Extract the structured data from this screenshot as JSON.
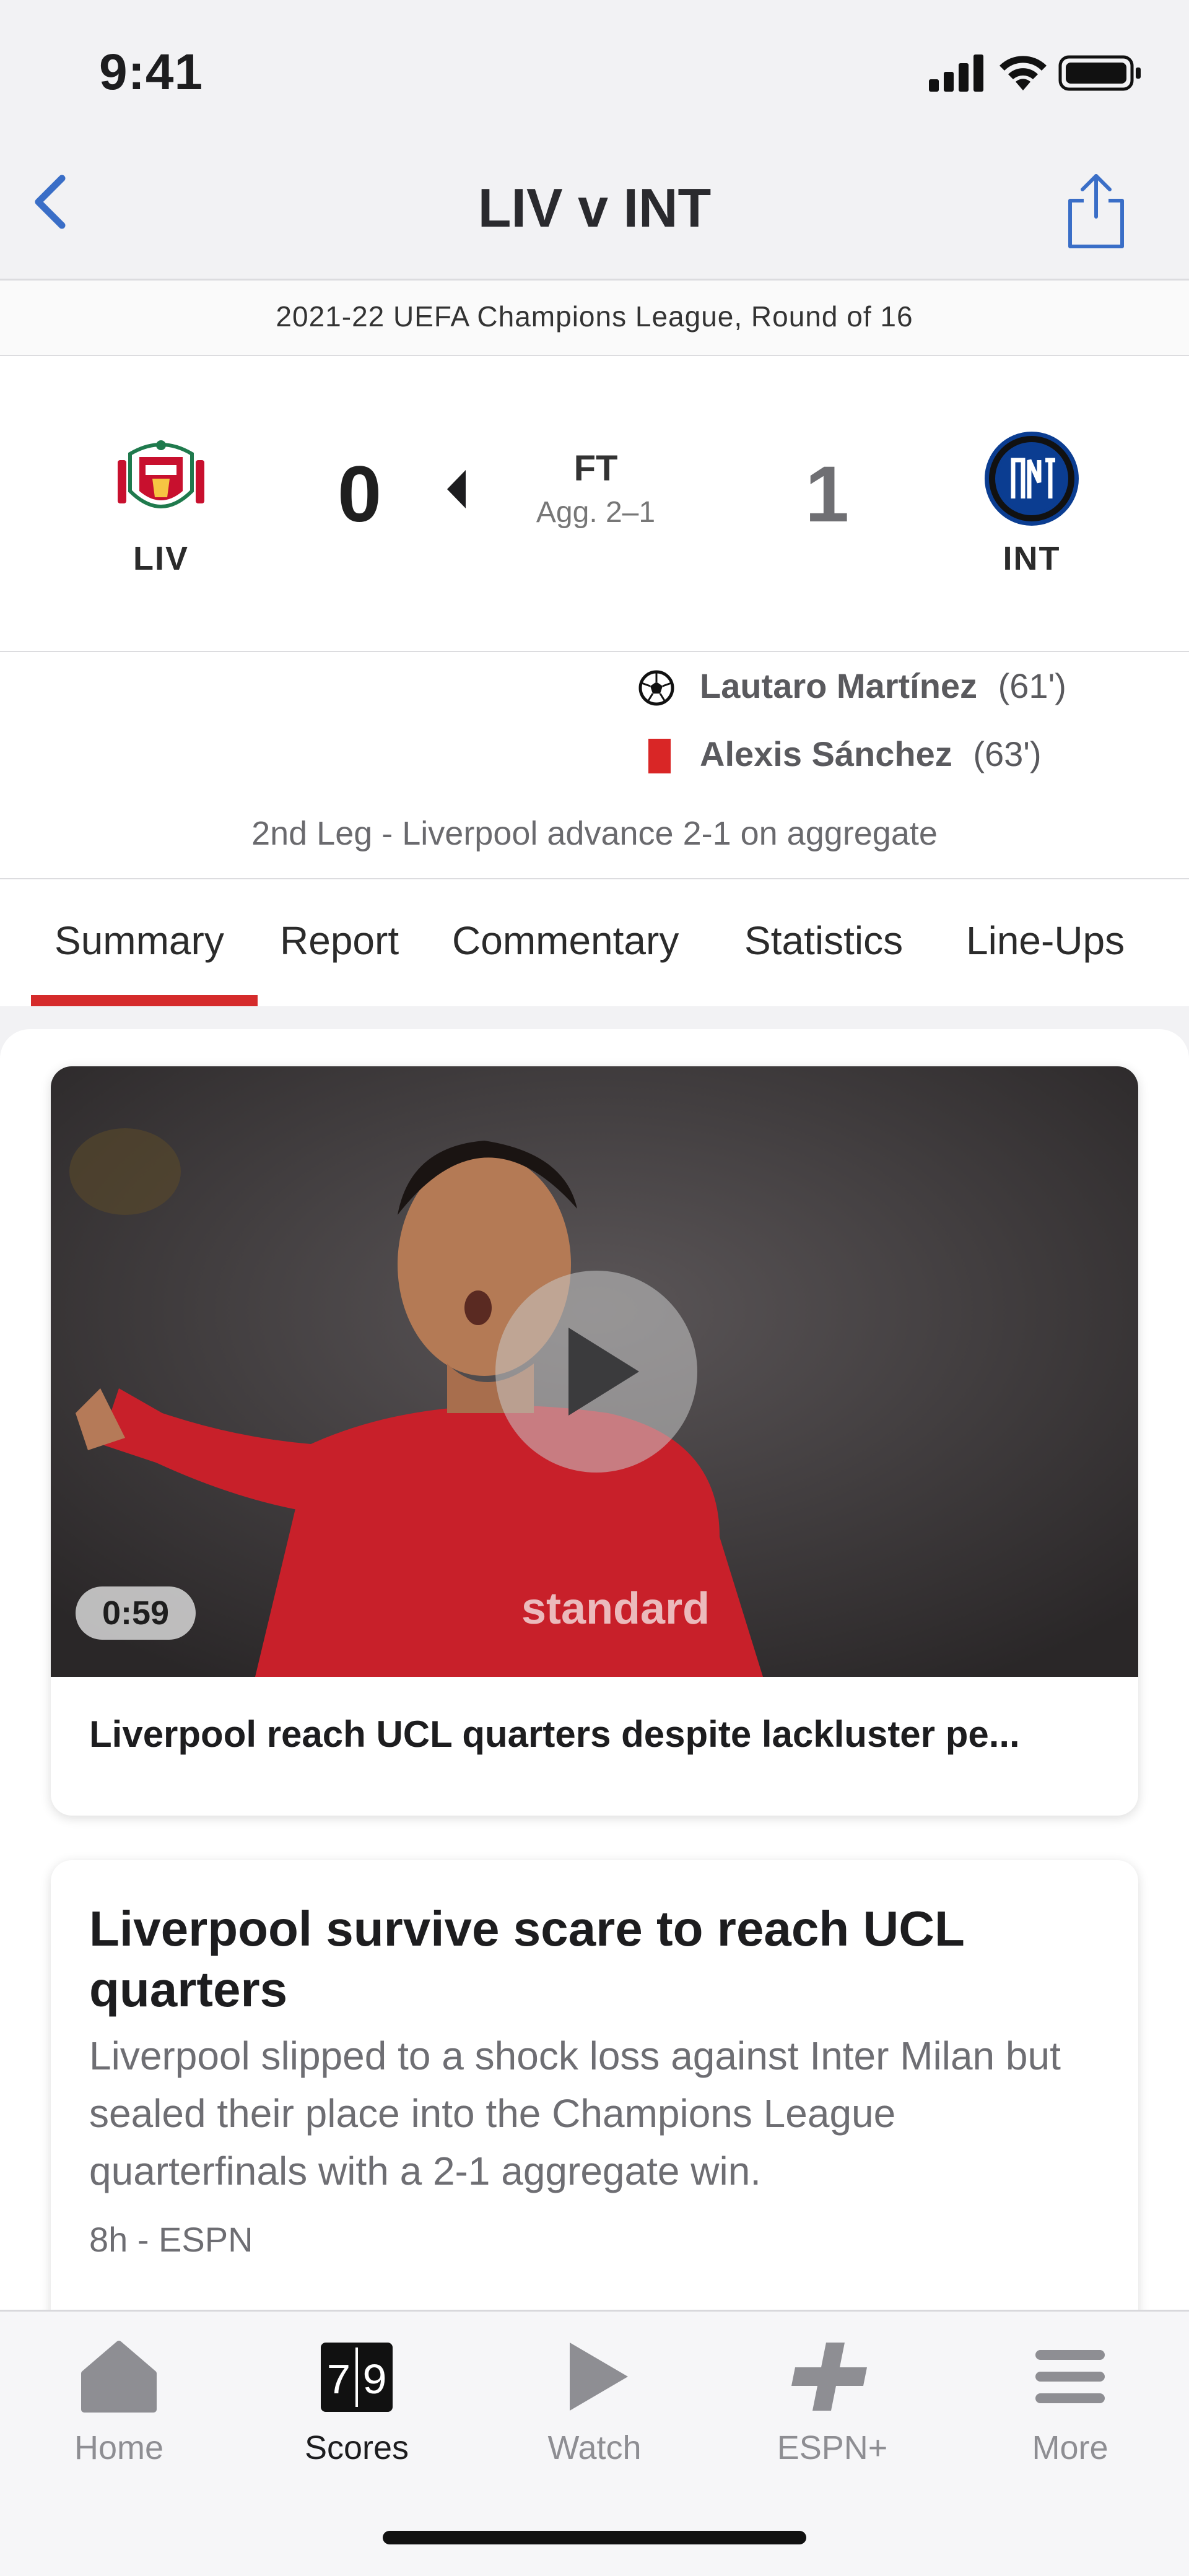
{
  "status_bar": {
    "time": "9:41"
  },
  "nav": {
    "title": "LIV v INT"
  },
  "competition": "2021-22 UEFA Champions League, Round of 16",
  "match": {
    "home": {
      "abbr": "LIV",
      "score": "0"
    },
    "away": {
      "abbr": "INT",
      "score": "1"
    },
    "status": "FT",
    "aggregate": "Agg. 2–1"
  },
  "events": [
    {
      "type": "goal",
      "icon": "soccer-ball-icon",
      "player": "Lautaro Martínez",
      "minute": "(61')"
    },
    {
      "type": "red-card",
      "icon": "red-card-icon",
      "player": "Alexis Sánchez",
      "minute": "(63')"
    }
  ],
  "leg_note": "2nd Leg - Liverpool advance 2-1 on aggregate",
  "tabs": [
    "Summary",
    "Report",
    "Commentary",
    "Statistics",
    "Line-Ups"
  ],
  "active_tab": "Summary",
  "video": {
    "duration": "0:59",
    "title": "Liverpool reach UCL quarters despite lackluster pe..."
  },
  "article": {
    "title": "Liverpool survive scare to reach UCL quarters",
    "summary": "Liverpool slipped to a shock loss against Inter Milan but sealed their place into the Champions League quarterfinals with a 2-1 aggregate win.",
    "meta": "8h - ESPN"
  },
  "tabbar": [
    {
      "label": "Home",
      "icon": "home-icon"
    },
    {
      "label": "Scores",
      "icon": "scoreboard-icon",
      "icon_text": "79"
    },
    {
      "label": "Watch",
      "icon": "play-icon"
    },
    {
      "label": "ESPN+",
      "icon": "espn-plus-icon"
    },
    {
      "label": "More",
      "icon": "menu-icon"
    }
  ],
  "colors": {
    "accent_blue": "#3a6ec7",
    "tab_indicator": "#d52b2b",
    "red_card": "#d92626"
  }
}
